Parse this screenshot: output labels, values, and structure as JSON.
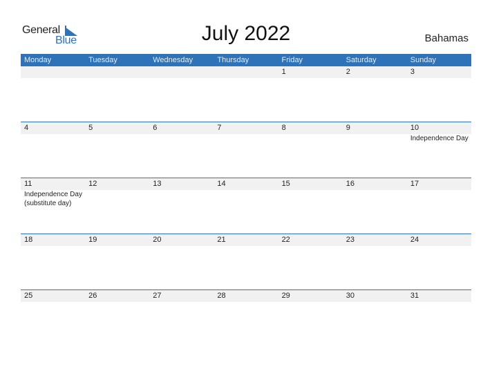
{
  "logo": {
    "text_general": "General",
    "text_blue": "Blue",
    "icon": "triangle-flag-icon"
  },
  "title": "July 2022",
  "country": "Bahamas",
  "colors": {
    "accent": "#2e73b8",
    "band": "#f1f1f1"
  },
  "weekdays": [
    "Monday",
    "Tuesday",
    "Wednesday",
    "Thursday",
    "Friday",
    "Saturday",
    "Sunday"
  ],
  "weeks": [
    {
      "days": [
        {
          "num": "",
          "event": ""
        },
        {
          "num": "",
          "event": ""
        },
        {
          "num": "",
          "event": ""
        },
        {
          "num": "",
          "event": ""
        },
        {
          "num": "1",
          "event": ""
        },
        {
          "num": "2",
          "event": ""
        },
        {
          "num": "3",
          "event": ""
        }
      ]
    },
    {
      "days": [
        {
          "num": "4",
          "event": ""
        },
        {
          "num": "5",
          "event": ""
        },
        {
          "num": "6",
          "event": ""
        },
        {
          "num": "7",
          "event": ""
        },
        {
          "num": "8",
          "event": ""
        },
        {
          "num": "9",
          "event": ""
        },
        {
          "num": "10",
          "event": "Independence Day"
        }
      ]
    },
    {
      "days": [
        {
          "num": "11",
          "event": "Independence Day (substitute day)"
        },
        {
          "num": "12",
          "event": ""
        },
        {
          "num": "13",
          "event": ""
        },
        {
          "num": "14",
          "event": ""
        },
        {
          "num": "15",
          "event": ""
        },
        {
          "num": "16",
          "event": ""
        },
        {
          "num": "17",
          "event": ""
        }
      ]
    },
    {
      "days": [
        {
          "num": "18",
          "event": ""
        },
        {
          "num": "19",
          "event": ""
        },
        {
          "num": "20",
          "event": ""
        },
        {
          "num": "21",
          "event": ""
        },
        {
          "num": "22",
          "event": ""
        },
        {
          "num": "23",
          "event": ""
        },
        {
          "num": "24",
          "event": ""
        }
      ]
    },
    {
      "days": [
        {
          "num": "25",
          "event": ""
        },
        {
          "num": "26",
          "event": ""
        },
        {
          "num": "27",
          "event": ""
        },
        {
          "num": "28",
          "event": ""
        },
        {
          "num": "29",
          "event": ""
        },
        {
          "num": "30",
          "event": ""
        },
        {
          "num": "31",
          "event": ""
        }
      ]
    }
  ]
}
